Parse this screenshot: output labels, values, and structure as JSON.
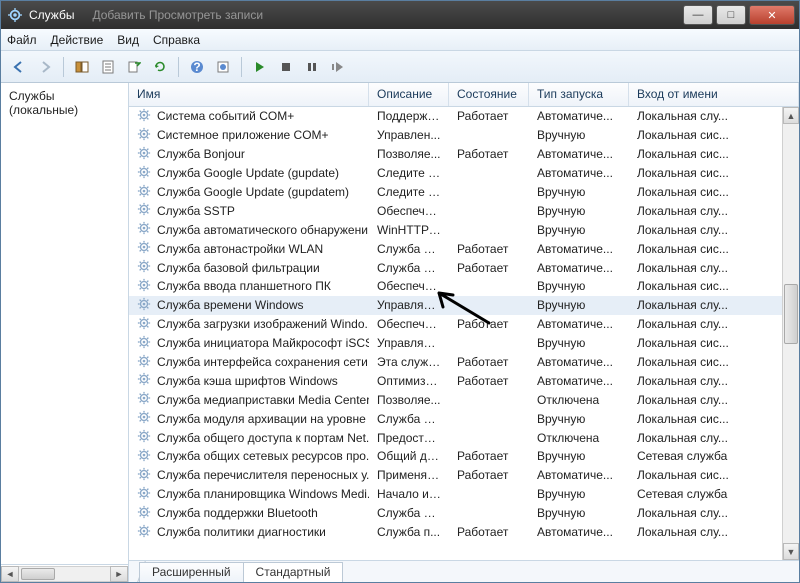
{
  "title": "Службы",
  "ghost_text": "Добавить     Просмотреть записи",
  "menu": {
    "file": "Файл",
    "action": "Действие",
    "view": "Вид",
    "help": "Справка"
  },
  "left_header": "Службы (локальные)",
  "columns": {
    "c0": "Имя",
    "c1": "Описание",
    "c2": "Состояние",
    "c3": "Тип запуска",
    "c4": "Вход от имени"
  },
  "tabs": {
    "ext": "Расширенный",
    "std": "Стандартный"
  },
  "winbtns": {
    "min": "—",
    "max": "□",
    "close": "✕"
  },
  "selected_index": 10,
  "rows": [
    {
      "name": "Система событий COM+",
      "desc": "Поддержк...",
      "state": "Работает",
      "start": "Автоматиче...",
      "logon": "Локальная слу..."
    },
    {
      "name": "Системное приложение COM+",
      "desc": "Управлен...",
      "state": "",
      "start": "Вручную",
      "logon": "Локальная сис..."
    },
    {
      "name": "Служба Bonjour",
      "desc": "Позволяе...",
      "state": "Работает",
      "start": "Автоматиче...",
      "logon": "Локальная сис..."
    },
    {
      "name": "Служба Google Update (gupdate)",
      "desc": "Следите за...",
      "state": "",
      "start": "Автоматиче...",
      "logon": "Локальная сис..."
    },
    {
      "name": "Служба Google Update (gupdatem)",
      "desc": "Следите за...",
      "state": "",
      "start": "Вручную",
      "logon": "Локальная сис..."
    },
    {
      "name": "Служба SSTP",
      "desc": "Обеспечи...",
      "state": "",
      "start": "Вручную",
      "logon": "Локальная слу..."
    },
    {
      "name": "Служба автоматического обнаружени...",
      "desc": "WinHTTP ...",
      "state": "",
      "start": "Вручную",
      "logon": "Локальная слу..."
    },
    {
      "name": "Служба автонастройки WLAN",
      "desc": "Служба W...",
      "state": "Работает",
      "start": "Автоматиче...",
      "logon": "Локальная сис..."
    },
    {
      "name": "Служба базовой фильтрации",
      "desc": "Служба ба...",
      "state": "Работает",
      "start": "Автоматиче...",
      "logon": "Локальная слу..."
    },
    {
      "name": "Служба ввода планшетного ПК",
      "desc": "Обеспечи...",
      "state": "",
      "start": "Вручную",
      "logon": "Локальная сис..."
    },
    {
      "name": "Служба времени Windows",
      "desc": "Управляет...",
      "state": "",
      "start": "Вручную",
      "logon": "Локальная слу..."
    },
    {
      "name": "Служба загрузки изображений Windo...",
      "desc": "Обеспечи...",
      "state": "Работает",
      "start": "Автоматиче...",
      "logon": "Локальная слу..."
    },
    {
      "name": "Служба инициатора Майкрософт iSCSI",
      "desc": "Управляет...",
      "state": "",
      "start": "Вручную",
      "logon": "Локальная сис..."
    },
    {
      "name": "Служба интерфейса сохранения сети",
      "desc": "Эта служб...",
      "state": "Работает",
      "start": "Автоматиче...",
      "logon": "Локальная сис..."
    },
    {
      "name": "Служба кэша шрифтов Windows",
      "desc": "Оптимизи...",
      "state": "Работает",
      "start": "Автоматиче...",
      "logon": "Локальная слу..."
    },
    {
      "name": "Служба медиаприставки Media Center",
      "desc": "Позволяе...",
      "state": "",
      "start": "Отключена",
      "logon": "Локальная слу..."
    },
    {
      "name": "Служба модуля архивации на уровне ...",
      "desc": "Служба W...",
      "state": "",
      "start": "Вручную",
      "logon": "Локальная сис..."
    },
    {
      "name": "Служба общего доступа к портам Net...",
      "desc": "Предостав...",
      "state": "",
      "start": "Отключена",
      "logon": "Локальная слу..."
    },
    {
      "name": "Служба общих сетевых ресурсов про...",
      "desc": "Общий до...",
      "state": "Работает",
      "start": "Вручную",
      "logon": "Сетевая служба"
    },
    {
      "name": "Служба перечислителя переносных у...",
      "desc": "Применяе...",
      "state": "Работает",
      "start": "Автоматиче...",
      "logon": "Локальная сис..."
    },
    {
      "name": "Служба планировщика Windows Medi...",
      "desc": "Начало и ...",
      "state": "",
      "start": "Вручную",
      "logon": "Сетевая служба"
    },
    {
      "name": "Служба поддержки Bluetooth",
      "desc": "Служба Bl...",
      "state": "",
      "start": "Вручную",
      "logon": "Локальная слу..."
    },
    {
      "name": "Служба политики диагностики",
      "desc": "Служба п...",
      "state": "Работает",
      "start": "Автоматиче...",
      "logon": "Локальная слу..."
    }
  ]
}
